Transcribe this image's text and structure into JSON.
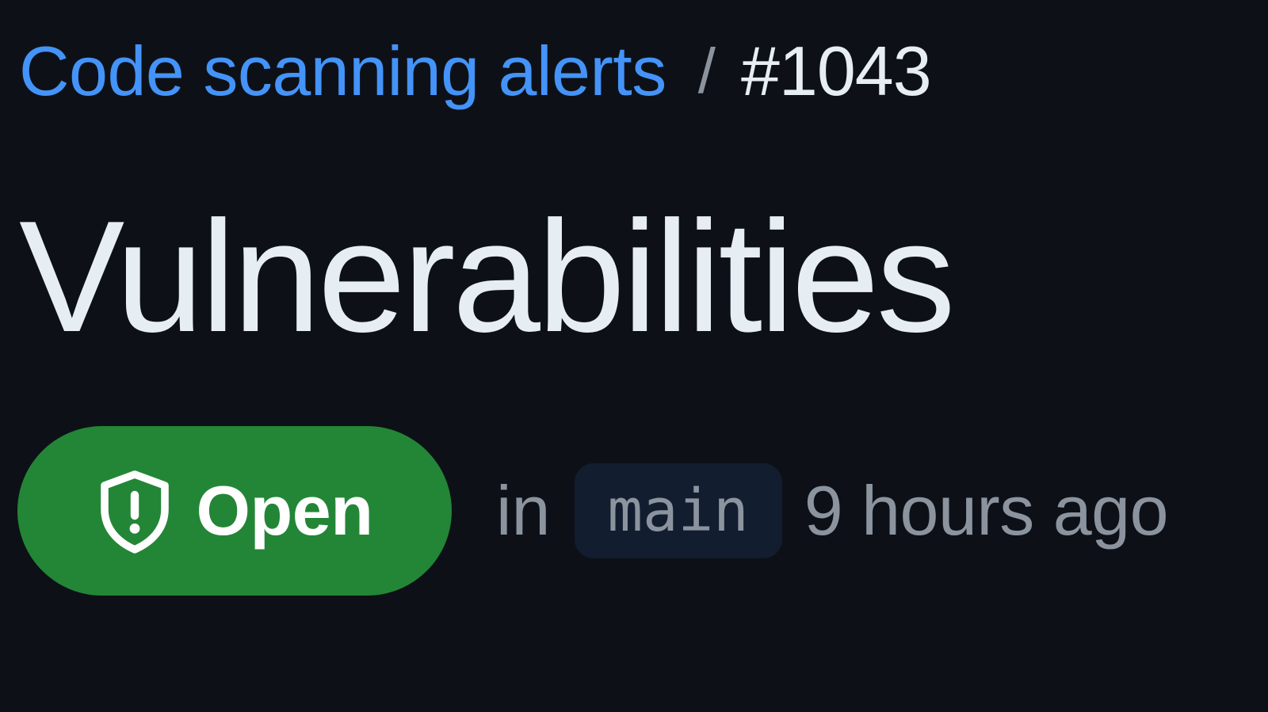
{
  "breadcrumb": {
    "parent_label": "Code scanning alerts",
    "separator": "/",
    "current_label": "#1043"
  },
  "alert": {
    "title": "Vulnerabilities",
    "status": {
      "label": "Open",
      "icon": "shield-alert-icon"
    },
    "in_text": "in",
    "branch": "main",
    "time_ago": "9 hours ago"
  },
  "colors": {
    "background": "#0d1117",
    "link": "#4493f8",
    "primary_text": "#e6edf3",
    "muted_text": "#8b949e",
    "open_badge": "#238636",
    "branch_chip": "#121d2f"
  }
}
